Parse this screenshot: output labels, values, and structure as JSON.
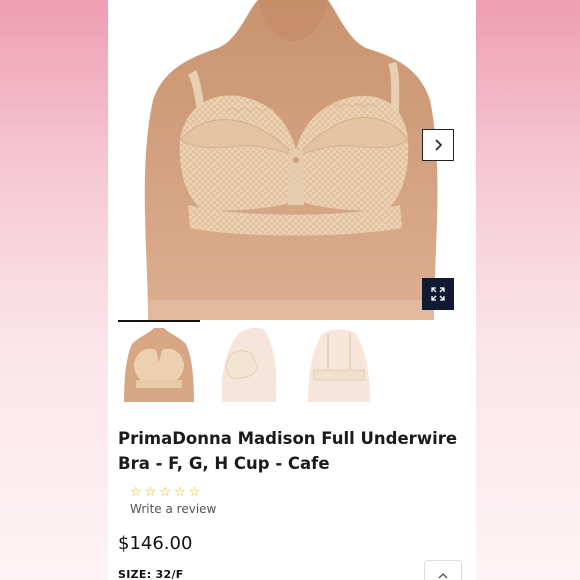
{
  "product": {
    "title_line1": "PrimaDonna Madison Full Underwire",
    "title_line2": "Bra - F, G, H Cup - Cafe",
    "review_link": "Write a review",
    "rating_stars": 5,
    "rating_value": 0,
    "price": "$146.00",
    "size_label": "SIZE:",
    "size_value": "32/F"
  },
  "gallery": {
    "active_index": 0,
    "thumbnail_count": 3
  },
  "icons": {
    "next": "chevron-right-icon",
    "zoom": "expand-icon",
    "star": "star-outline-icon",
    "scroll_top": "chevron-up-icon"
  },
  "colors": {
    "accent_dark": "#111a33",
    "star": "#e9b400",
    "fabric": "#ecd3b5",
    "skin": "#d8a788",
    "side_pink": "#ee9eb2"
  }
}
